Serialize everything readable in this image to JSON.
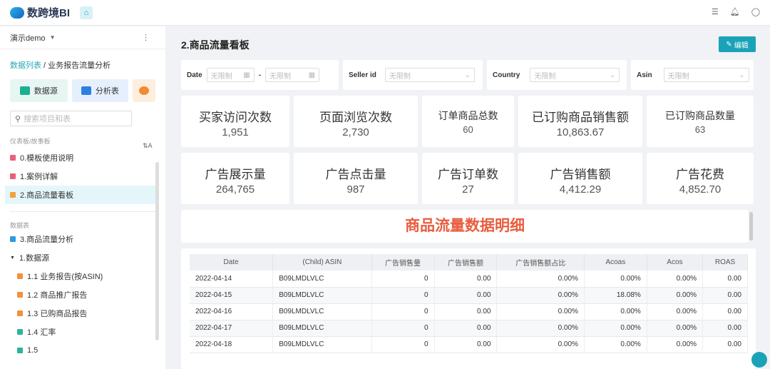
{
  "app": {
    "name": "数跨境BI"
  },
  "sidebar": {
    "workspace": "演示demo",
    "breadcrumb_root": "数据列表",
    "breadcrumb_current": "业务报告流量分析",
    "tiles": [
      "数据源",
      "分析表"
    ],
    "search_placeholder": "搜索项目和表",
    "section_dash": "仪表板/故事板",
    "dash_items": [
      "0.模板使用说明",
      "1.案例详解",
      "2.商品流量看板"
    ],
    "section_tables": "数据表",
    "table_items": [
      "3.商品流量分析",
      "1.数据源",
      "1.1 业务报告(按ASIN)",
      "1.2 商品推广报告",
      "1.3 已购商品报告",
      "1.4 汇率",
      "1.5"
    ]
  },
  "main": {
    "title": "2.商品流量看板",
    "edit": "编辑",
    "filters": {
      "date": "Date",
      "seller": "Seller id",
      "country": "Country",
      "asin": "Asin",
      "placeholder": "无限制"
    },
    "kpis": [
      {
        "label": "买家访问次数",
        "value": "1,951"
      },
      {
        "label": "页面浏览次数",
        "value": "2,730"
      },
      {
        "label": "订单商品总数",
        "value": "60"
      },
      {
        "label": "已订购商品销售额",
        "value": "10,863.67"
      },
      {
        "label": "已订购商品数量",
        "value": "63"
      },
      {
        "label": "广告展示量",
        "value": "264,765"
      },
      {
        "label": "广告点击量",
        "value": "987"
      },
      {
        "label": "广告订单数",
        "value": "27"
      },
      {
        "label": "广告销售额",
        "value": "4,412.29"
      },
      {
        "label": "广告花费",
        "value": "4,852.70"
      }
    ],
    "detail_title": "商品流量数据明细",
    "table": {
      "columns": [
        "Date",
        "(Child) ASIN",
        "广告销售量",
        "广告销售额",
        "广告销售额占比",
        "Acoas",
        "Acos",
        "ROAS"
      ],
      "rows": [
        [
          "2022-04-14",
          "B09LMDLVLC",
          "0",
          "0.00",
          "0.00%",
          "0.00%",
          "0.00%",
          "0.00"
        ],
        [
          "2022-04-15",
          "B09LMDLVLC",
          "0",
          "0.00",
          "0.00%",
          "18.08%",
          "0.00%",
          "0.00"
        ],
        [
          "2022-04-16",
          "B09LMDLVLC",
          "0",
          "0.00",
          "0.00%",
          "0.00%",
          "0.00%",
          "0.00"
        ],
        [
          "2022-04-17",
          "B09LMDLVLC",
          "0",
          "0.00",
          "0.00%",
          "0.00%",
          "0.00%",
          "0.00"
        ],
        [
          "2022-04-18",
          "B09LMDLVLC",
          "0",
          "0.00",
          "0.00%",
          "0.00%",
          "0.00%",
          "0.00"
        ]
      ]
    }
  }
}
